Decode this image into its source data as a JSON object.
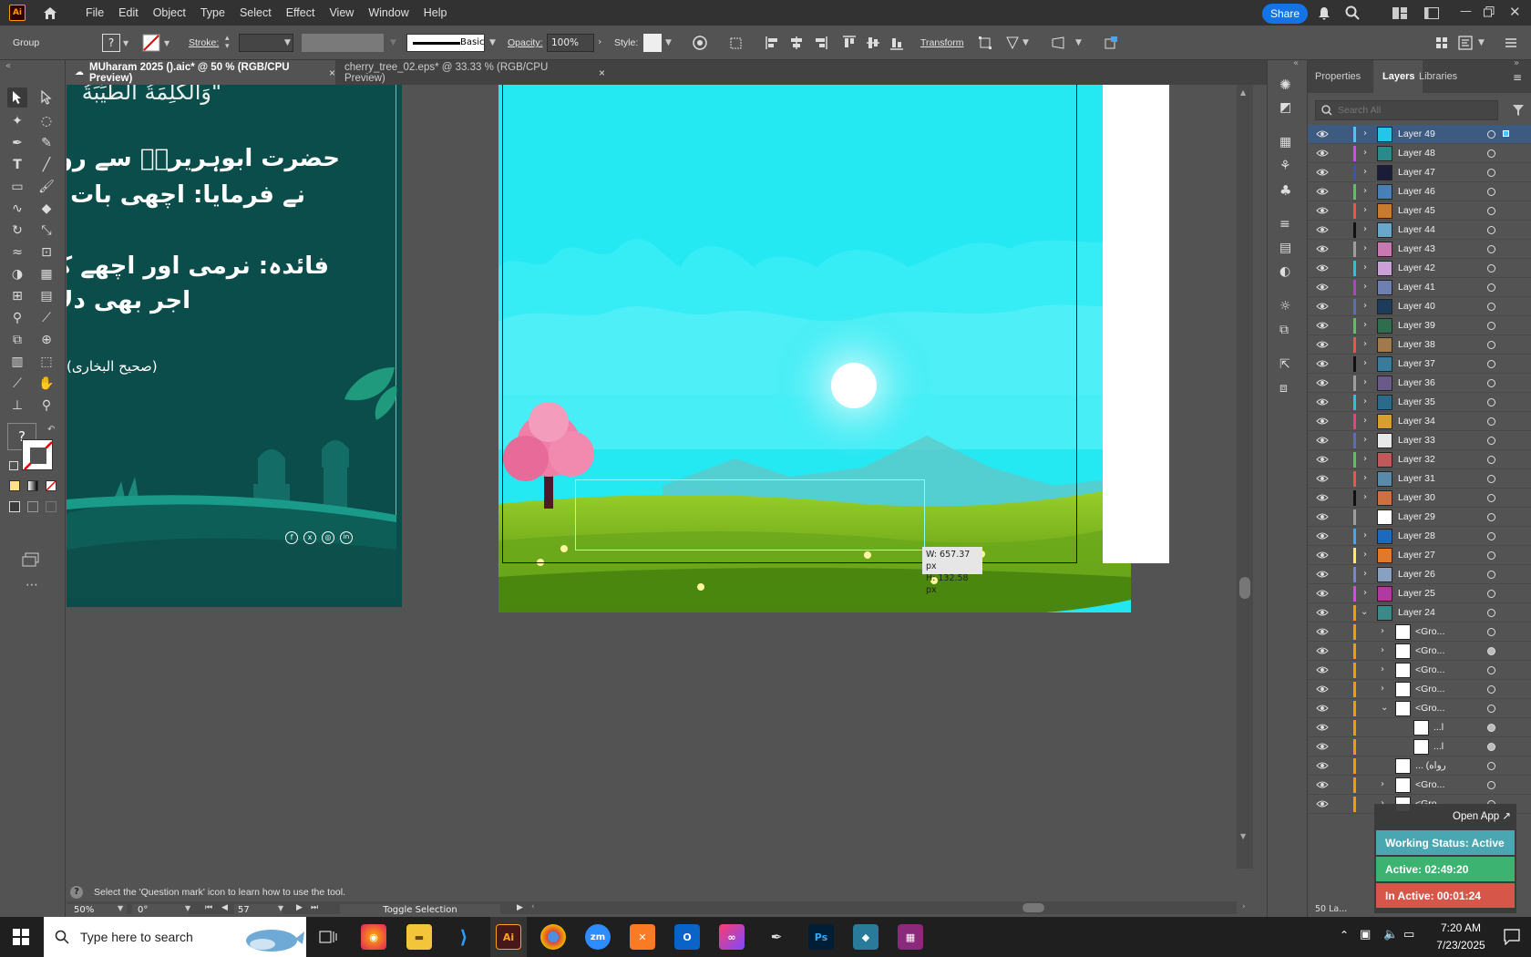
{
  "menu": [
    "File",
    "Edit",
    "Object",
    "Type",
    "Select",
    "Effect",
    "View",
    "Window",
    "Help"
  ],
  "share_label": "Share",
  "control": {
    "selection_type": "Group",
    "stroke_label": "Stroke:",
    "brush_label": "Basic",
    "opacity_label": "Opacity:",
    "opacity_value": "100%",
    "style_label": "Style:",
    "transform_label": "Transform"
  },
  "tabs": [
    {
      "label": "MUharam 2025 ().aic* @ 50 % (RGB/CPU Preview)",
      "close": "×"
    },
    {
      "label": "cherry_tree_02.eps* @ 33.33 % (RGB/CPU Preview)",
      "close": "×"
    }
  ],
  "artboard_left": {
    "top_text": "\"وَالْكَلِمَةُ الطَّيِّبَةُ",
    "line1": "حضرت ابوہریرہؓ سے روایت",
    "line2": "نے فرمایا: اچھی بات کہ",
    "line3": "فائدہ: نرمی اور اچھے کلمہ",
    "line4": "اجر بھی دلا",
    "line5": "(صحیح البخاری)"
  },
  "measure": {
    "w": "W: 657.37 px",
    "h": "H: 132.58 px"
  },
  "panel_tabs": {
    "properties": "Properties",
    "layers": "Layers",
    "libraries": "Libraries"
  },
  "search_placeholder": "Search All",
  "layers": [
    {
      "name": "Layer 49",
      "color": "#4fc3f7",
      "thumb": "#22c7e8",
      "expanded": false,
      "selected": true
    },
    {
      "name": "Layer 48",
      "color": "#e040fb",
      "thumb": "#2a8a8a",
      "expanded": false
    },
    {
      "name": "Layer 47",
      "color": "#3f51b5",
      "thumb": "#1b1b3a",
      "expanded": false
    },
    {
      "name": "Layer 46",
      "color": "#66bb6a",
      "thumb": "#4a7fb5",
      "expanded": false
    },
    {
      "name": "Layer 45",
      "color": "#ef5350",
      "thumb": "#c97a2a",
      "expanded": false
    },
    {
      "name": "Layer 44",
      "color": "#111111",
      "thumb": "#6aa6c9",
      "expanded": false
    },
    {
      "name": "Layer 43",
      "color": "#9e9e9e",
      "thumb": "#c87ab0",
      "expanded": false
    },
    {
      "name": "Layer 42",
      "color": "#26c6da",
      "thumb": "#c9a1d6",
      "expanded": false
    },
    {
      "name": "Layer 41",
      "color": "#ab47bc",
      "thumb": "#6e7fb0",
      "expanded": false
    },
    {
      "name": "Layer 40",
      "color": "#5c6bc0",
      "thumb": "#1d3b5a",
      "expanded": false
    },
    {
      "name": "Layer 39",
      "color": "#66bb6a",
      "thumb": "#2e6e4e",
      "expanded": false
    },
    {
      "name": "Layer 38",
      "color": "#ef5350",
      "thumb": "#a07a4a",
      "expanded": false
    },
    {
      "name": "Layer 37",
      "color": "#111111",
      "thumb": "#3a7a9a",
      "expanded": false
    },
    {
      "name": "Layer 36",
      "color": "#9e9e9e",
      "thumb": "#6a5a8a",
      "expanded": false
    },
    {
      "name": "Layer 35",
      "color": "#26c6da",
      "thumb": "#2a6a8a",
      "expanded": false
    },
    {
      "name": "Layer 34",
      "color": "#ec407a",
      "thumb": "#d6a02a",
      "expanded": false
    },
    {
      "name": "Layer 33",
      "color": "#5c6bc0",
      "thumb": "#e8e8e8",
      "expanded": false
    },
    {
      "name": "Layer 32",
      "color": "#66bb6a",
      "thumb": "#c05a5a",
      "expanded": false
    },
    {
      "name": "Layer 31",
      "color": "#ef5350",
      "thumb": "#5a8aaa",
      "expanded": false
    },
    {
      "name": "Layer 30",
      "color": "#111111",
      "thumb": "#d07040",
      "expanded": false
    },
    {
      "name": "Layer 29",
      "color": "#9e9e9e",
      "thumb": "#ffffff",
      "expanded": null
    },
    {
      "name": "Layer 28",
      "color": "#42a5f5",
      "thumb": "#1a6ac0",
      "expanded": false
    },
    {
      "name": "Layer 27",
      "color": "#ffee58",
      "thumb": "#e07a2a",
      "expanded": false
    },
    {
      "name": "Layer 26",
      "color": "#7986cb",
      "thumb": "#8aa0c0",
      "expanded": false
    },
    {
      "name": "Layer 25",
      "color": "#e040fb",
      "thumb": "#b03aa0",
      "expanded": false
    },
    {
      "name": "Layer 24",
      "color": "#ff9800",
      "thumb": "#3a8a8a",
      "expanded": true
    }
  ],
  "sublayers": [
    {
      "name": "<Gro...",
      "indent": 1,
      "expanded": false,
      "filled": false
    },
    {
      "name": "<Gro...",
      "indent": 1,
      "expanded": false,
      "filled": true
    },
    {
      "name": "<Gro...",
      "indent": 1,
      "expanded": false,
      "filled": false
    },
    {
      "name": "<Gro...",
      "indent": 1,
      "expanded": false,
      "filled": false
    },
    {
      "name": "<Gro...",
      "indent": 1,
      "expanded": true,
      "filled": false
    },
    {
      "name": "...l",
      "indent": 2,
      "expanded": null,
      "filled": true
    },
    {
      "name": "...l",
      "indent": 2,
      "expanded": null,
      "filled": true
    },
    {
      "name": "... (رواه",
      "indent": 1,
      "expanded": null,
      "filled": false
    },
    {
      "name": "<Gro...",
      "indent": 1,
      "expanded": false,
      "filled": false
    },
    {
      "name": "<Gro...",
      "indent": 1,
      "expanded": false,
      "filled": false
    }
  ],
  "panel_footer": "50 La...",
  "widget": {
    "open_app": "Open App ↗",
    "working_status": "Working Status: Active",
    "active": "Active: 02:49:20",
    "inactive": "In Active: 00:01:24"
  },
  "status": {
    "hint": "Select the 'Question mark' icon to learn how to use the tool.",
    "zoom": "50%",
    "rotation": "0°",
    "artboard": "57",
    "toggle": "Toggle Selection"
  },
  "taskbar": {
    "search_placeholder": "Type here to search",
    "time": "7:20 AM",
    "date": "7/23/2025"
  }
}
